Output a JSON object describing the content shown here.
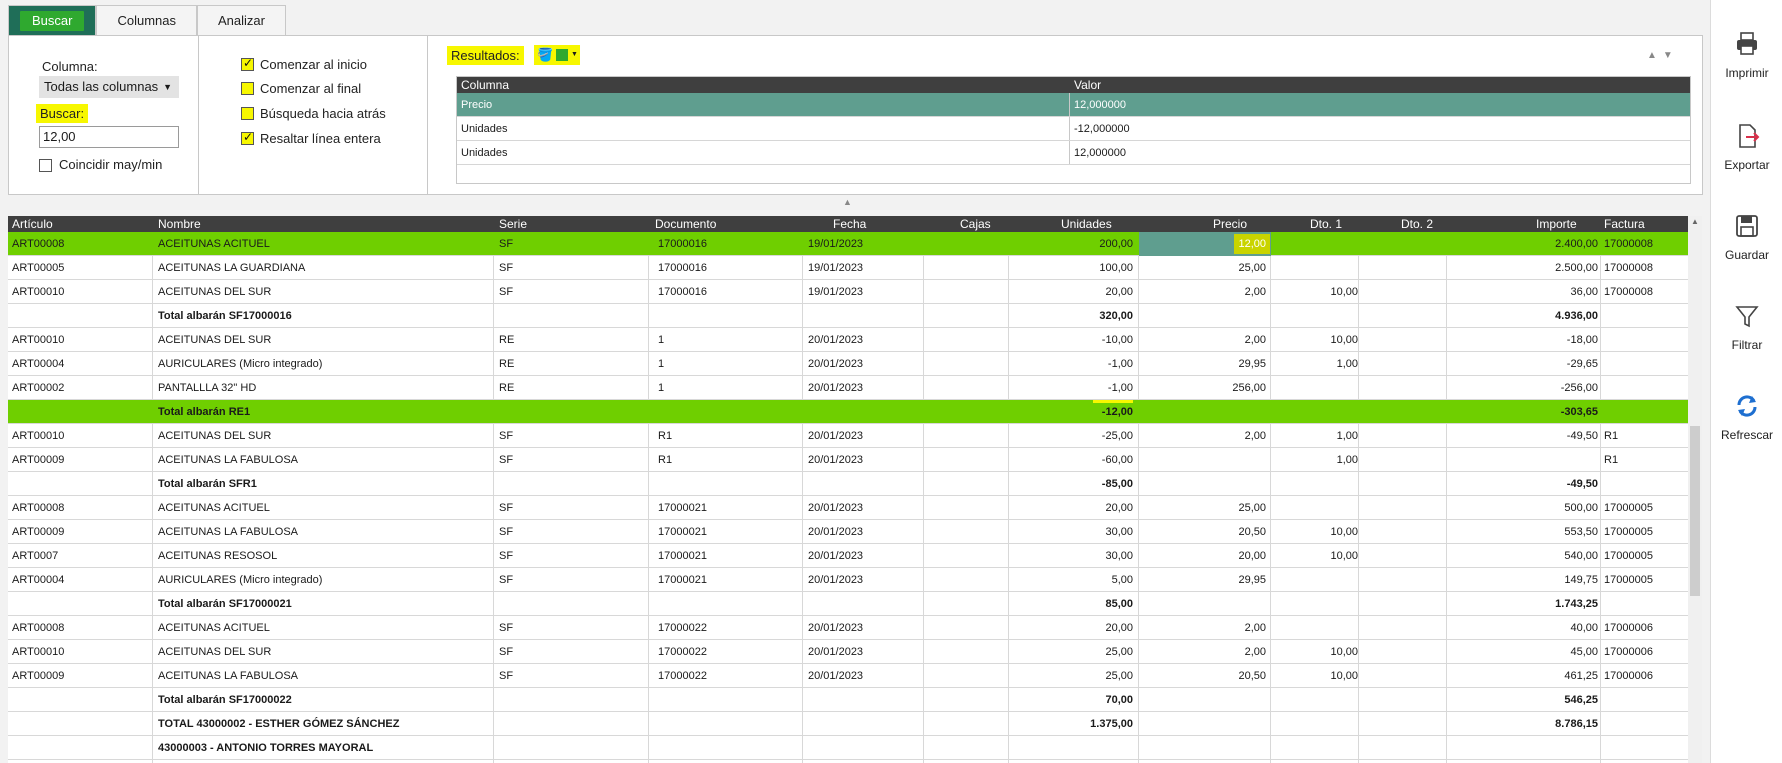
{
  "tabs": [
    "Buscar",
    "Columnas",
    "Analizar"
  ],
  "search": {
    "columna_label": "Columna:",
    "columna_value": "Todas las columnas",
    "buscar_label": "Buscar:",
    "buscar_value": "12,00",
    "coincidir_label": "Coincidir may/min",
    "options": [
      {
        "label": "Comenzar al inicio",
        "checked": true
      },
      {
        "label": "Comenzar al final",
        "checked": false
      },
      {
        "label": "Búsqueda hacia atrás",
        "checked": false
      },
      {
        "label": "Resaltar línea entera",
        "checked": true
      }
    ],
    "resultados_label": "Resultados:",
    "results_headers": [
      "Columna",
      "Valor"
    ],
    "results": [
      [
        "Precio",
        "12,000000"
      ],
      [
        "Unidades",
        "-12,000000"
      ],
      [
        "Unidades",
        "12,000000"
      ]
    ]
  },
  "grid": {
    "headers": [
      "Artículo",
      "Nombre",
      "Serie",
      "Documento",
      "Fecha",
      "Cajas",
      "Unidades",
      "Precio",
      "Dto. 1",
      "Dto. 2",
      "Importe",
      "Factura"
    ],
    "rows": [
      {
        "style": "green",
        "cells": [
          "ART00008",
          "ACEITUNAS ACITUEL",
          "SF",
          "17000016",
          "19/01/2023",
          "",
          "200,00",
          "12,00",
          "",
          "",
          "2.400,00",
          "17000008"
        ]
      },
      {
        "style": "",
        "cells": [
          "ART00005",
          "ACEITUNAS LA GUARDIANA",
          "SF",
          "17000016",
          "19/01/2023",
          "",
          "100,00",
          "25,00",
          "",
          "",
          "2.500,00",
          "17000008"
        ]
      },
      {
        "style": "",
        "cells": [
          "ART00010",
          "ACEITUNAS DEL SUR",
          "SF",
          "17000016",
          "19/01/2023",
          "",
          "20,00",
          "2,00",
          "10,00",
          "",
          "36,00",
          "17000008"
        ]
      },
      {
        "style": "bold",
        "cells": [
          "",
          "Total albarán SF17000016",
          "",
          "",
          "",
          "",
          "320,00",
          "",
          "",
          "",
          "4.936,00",
          ""
        ]
      },
      {
        "style": "",
        "cells": [
          "ART00010",
          "ACEITUNAS DEL SUR",
          "RE",
          "1",
          "20/01/2023",
          "",
          "-10,00",
          "2,00",
          "10,00",
          "",
          "-18,00",
          ""
        ]
      },
      {
        "style": "",
        "cells": [
          "ART00004",
          "AURICULARES (Micro integrado)",
          "RE",
          "1",
          "20/01/2023",
          "",
          "-1,00",
          "29,95",
          "1,00",
          "",
          "-29,65",
          ""
        ]
      },
      {
        "style": "",
        "cells": [
          "ART00002",
          "PANTALLLA 32\" HD",
          "RE",
          "1",
          "20/01/2023",
          "",
          "-1,00",
          "256,00",
          "",
          "",
          "-256,00",
          ""
        ]
      },
      {
        "style": "green bold",
        "cells": [
          "",
          "Total albarán RE1",
          "",
          "",
          "",
          "",
          "-12,00",
          "",
          "",
          "",
          "-303,65",
          ""
        ]
      },
      {
        "style": "",
        "cells": [
          "ART00010",
          "ACEITUNAS DEL SUR",
          "SF",
          "R1",
          "20/01/2023",
          "",
          "-25,00",
          "2,00",
          "1,00",
          "",
          "-49,50",
          "R1"
        ]
      },
      {
        "style": "",
        "cells": [
          "ART00009",
          "ACEITUNAS LA FABULOSA",
          "SF",
          "R1",
          "20/01/2023",
          "",
          "-60,00",
          "",
          "1,00",
          "",
          "",
          "R1"
        ]
      },
      {
        "style": "bold",
        "cells": [
          "",
          "Total albarán SFR1",
          "",
          "",
          "",
          "",
          "-85,00",
          "",
          "",
          "",
          "-49,50",
          ""
        ]
      },
      {
        "style": "",
        "cells": [
          "ART00008",
          "ACEITUNAS ACITUEL",
          "SF",
          "17000021",
          "20/01/2023",
          "",
          "20,00",
          "25,00",
          "",
          "",
          "500,00",
          "17000005"
        ]
      },
      {
        "style": "",
        "cells": [
          "ART00009",
          "ACEITUNAS LA FABULOSA",
          "SF",
          "17000021",
          "20/01/2023",
          "",
          "30,00",
          "20,50",
          "10,00",
          "",
          "553,50",
          "17000005"
        ]
      },
      {
        "style": "",
        "cells": [
          "ART0007",
          "ACEITUNAS RESOSOL",
          "SF",
          "17000021",
          "20/01/2023",
          "",
          "30,00",
          "20,00",
          "10,00",
          "",
          "540,00",
          "17000005"
        ]
      },
      {
        "style": "",
        "cells": [
          "ART00004",
          "AURICULARES (Micro integrado)",
          "SF",
          "17000021",
          "20/01/2023",
          "",
          "5,00",
          "29,95",
          "",
          "",
          "149,75",
          "17000005"
        ]
      },
      {
        "style": "bold",
        "cells": [
          "",
          "Total albarán SF17000021",
          "",
          "",
          "",
          "",
          "85,00",
          "",
          "",
          "",
          "1.743,25",
          ""
        ]
      },
      {
        "style": "",
        "cells": [
          "ART00008",
          "ACEITUNAS ACITUEL",
          "SF",
          "17000022",
          "20/01/2023",
          "",
          "20,00",
          "2,00",
          "",
          "",
          "40,00",
          "17000006"
        ]
      },
      {
        "style": "",
        "cells": [
          "ART00010",
          "ACEITUNAS DEL SUR",
          "SF",
          "17000022",
          "20/01/2023",
          "",
          "25,00",
          "2,00",
          "10,00",
          "",
          "45,00",
          "17000006"
        ]
      },
      {
        "style": "",
        "cells": [
          "ART00009",
          "ACEITUNAS LA FABULOSA",
          "SF",
          "17000022",
          "20/01/2023",
          "",
          "25,00",
          "20,50",
          "10,00",
          "",
          "461,25",
          "17000006"
        ]
      },
      {
        "style": "bold",
        "cells": [
          "",
          "Total albarán SF17000022",
          "",
          "",
          "",
          "",
          "70,00",
          "",
          "",
          "",
          "546,25",
          ""
        ]
      },
      {
        "style": "bold",
        "cells": [
          "",
          "TOTAL 43000002 - ESTHER GÓMEZ SÁNCHEZ",
          "",
          "",
          "",
          "",
          "1.375,00",
          "",
          "",
          "",
          "8.786,15",
          ""
        ]
      },
      {
        "style": "bold",
        "cells": [
          "",
          "43000003 - ANTONIO TORRES MAYORAL",
          "",
          "",
          "",
          "",
          "",
          "",
          "",
          "",
          "",
          ""
        ]
      }
    ]
  },
  "sidebar": [
    {
      "label": "Imprimir",
      "icon": "printer-icon"
    },
    {
      "label": "Exportar",
      "icon": "export-icon"
    },
    {
      "label": "Guardar",
      "icon": "save-icon"
    },
    {
      "label": "Filtrar",
      "icon": "filter-icon"
    },
    {
      "label": "Refrescar",
      "icon": "refresh-icon"
    }
  ],
  "colors": {
    "accent_green": "#6fcf00",
    "tab_active": "#1f6e58",
    "selection_teal": "#5f9e8f",
    "highlight_yellow": "#f7f700",
    "header_dark": "#3f3f3f"
  }
}
